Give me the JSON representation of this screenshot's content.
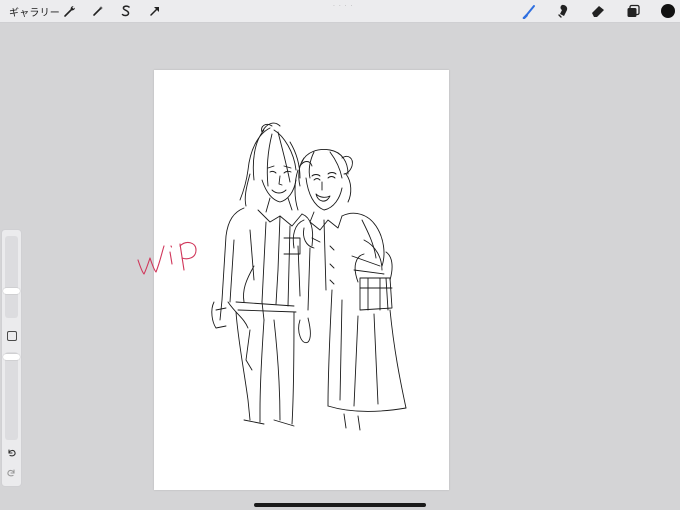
{
  "topbar": {
    "gallery_label": "ギャラリー",
    "grabber": "· · · ·"
  },
  "tools_left": [
    {
      "icon": "wrench-icon"
    },
    {
      "icon": "magic-wand-icon"
    },
    {
      "icon": "selection-s-icon"
    },
    {
      "icon": "transform-arrow-icon"
    }
  ],
  "tools_right": [
    {
      "icon": "brush-icon",
      "active": true,
      "color": "#2f6fe0"
    },
    {
      "icon": "smudge-icon"
    },
    {
      "icon": "eraser-icon"
    },
    {
      "icon": "layers-icon"
    },
    {
      "icon": "color-swatch-icon",
      "color": "#111111"
    }
  ],
  "canvas": {
    "annotation_text": "wip",
    "annotation_color": "#d0365a"
  },
  "sidebar": {
    "size_slider_level": 0.8,
    "opacity_slider_level": 0.15
  },
  "colors": {
    "background": "#d4d4d6",
    "toolbar": "#ececee",
    "accent": "#2f6fe0"
  }
}
